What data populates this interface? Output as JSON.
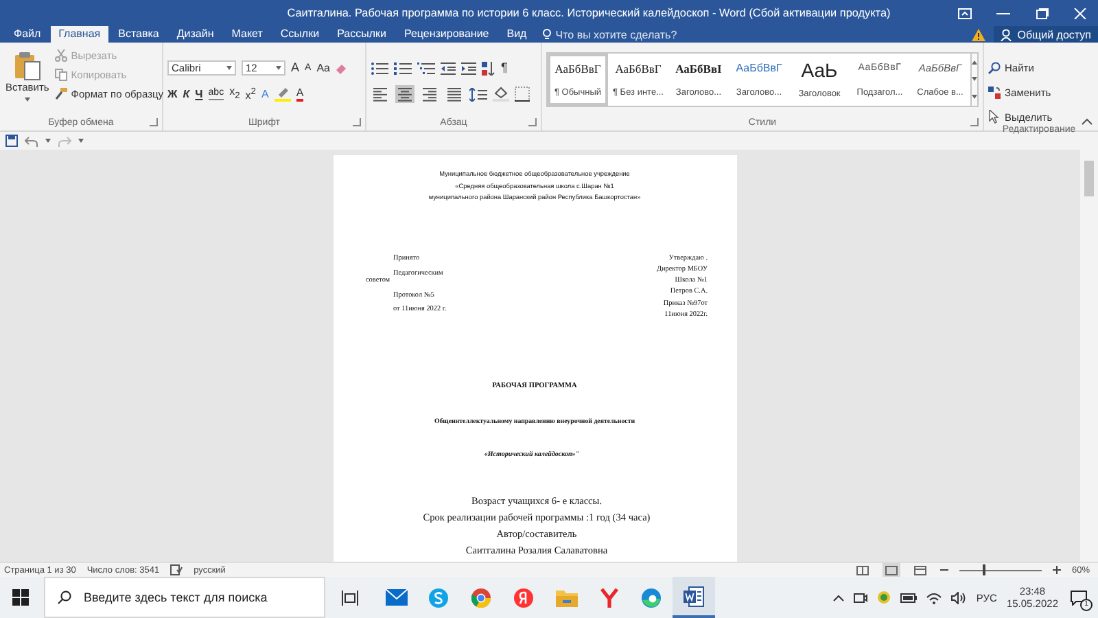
{
  "title_bar": {
    "title": "Саитгалина. Рабочая программа по истории 6 класс. Исторический калейдоскоп - Word (Сбой активации продукта)"
  },
  "tabs": [
    {
      "label": "Файл",
      "selected": false
    },
    {
      "label": "Главная",
      "selected": true
    },
    {
      "label": "Вставка",
      "selected": false
    },
    {
      "label": "Дизайн",
      "selected": false
    },
    {
      "label": "Макет",
      "selected": false
    },
    {
      "label": "Ссылки",
      "selected": false
    },
    {
      "label": "Рассылки",
      "selected": false
    },
    {
      "label": "Рецензирование",
      "selected": false
    },
    {
      "label": "Вид",
      "selected": false
    }
  ],
  "tell_me": {
    "placeholder": "Что вы хотите сделать?"
  },
  "share": {
    "label": "Общий доступ"
  },
  "clipboard": {
    "paste": "Вставить",
    "items": [
      {
        "label": "Вырезать",
        "kind": "cut",
        "disabled": true
      },
      {
        "label": "Копировать",
        "kind": "copy",
        "disabled": true
      },
      {
        "label": "Формат по образцу",
        "kind": "painter",
        "disabled": false
      }
    ],
    "label": "Буфер обмена"
  },
  "font": {
    "font_name": "Calibri",
    "font_size": "12",
    "grow": "A",
    "shrink": "A",
    "change_case": "Aa",
    "format_buttons": [
      "Ж",
      "К",
      "Ч",
      "abc",
      "x$_{2}$",
      "x$^{2}$"
    ],
    "effects": "A",
    "font_color": "A",
    "label": "Шрифт"
  },
  "paragraph": {
    "pilcrow": "¶",
    "alignments": [
      {
        "kind": "left",
        "selected": false
      },
      {
        "kind": "center",
        "selected": true
      },
      {
        "kind": "right",
        "selected": false
      },
      {
        "kind": "justify",
        "selected": false
      }
    ],
    "label": "Абзац"
  },
  "styles": {
    "items": [
      {
        "preview": "АаБбВвГ",
        "name": "¶ Обычный",
        "kind": "normal",
        "selected": true
      },
      {
        "preview": "АаБбВвГ",
        "name": "¶ Без инте...",
        "kind": "normal",
        "selected": false
      },
      {
        "preview": "АаБбВвI",
        "name": "Заголово...",
        "kind": "heading1",
        "selected": false
      },
      {
        "preview": "АаБбВвГ",
        "name": "Заголово...",
        "kind": "heading2",
        "selected": false
      },
      {
        "preview": "АаЬ",
        "name": "Заголовок",
        "kind": "title",
        "selected": false
      },
      {
        "preview": "АаБбВвГ",
        "name": "Подзагол...",
        "kind": "subtitle",
        "selected": false
      },
      {
        "preview": "АаБбВвГ",
        "name": "Слабое в...",
        "kind": "subtle",
        "selected": false
      }
    ],
    "label": "Стили"
  },
  "editing": {
    "items": [
      {
        "label": "Найти",
        "kind": "find"
      },
      {
        "label": "Заменить",
        "kind": "replace"
      },
      {
        "label": "Выделить",
        "kind": "select"
      }
    ],
    "label": "Редактирование"
  },
  "document": {
    "header_lines": [
      "Муниципальное бюджетное общеобразовательное учреждение",
      "«Средняя общеобразовательная школа с.Шаран №1",
      "муниципального района Шаранский район Республика Башкортостан»"
    ],
    "approved_left": [
      "Принято",
      "Педагогическим",
      "советом",
      "Протокол №5",
      "от 11июня 2022 г."
    ],
    "approved_right": [
      "Утверждаю .",
      "Директор МБОУ",
      "Школа №1",
      "Петров С.А.",
      "Приказ №97от",
      "11июня 2022г."
    ],
    "title": "РАБОЧАЯ ПРОГРАММА",
    "direction": "Общеинтеллектуальному направлению внеурочной деятельности",
    "course": "«Исторический калейдоскоп»\"",
    "info_lines": [
      "Возраст учащихся 6- е классы.",
      "Срок реализации рабочей программы :1 год (34 часа)",
      "Автор/составитель",
      "Саитгалина Розалия Салаватовна"
    ]
  },
  "status_bar": {
    "page": "Страница 1 из 30",
    "words": "Число слов: 3541",
    "language": "русский",
    "views": [
      {
        "kind": "read",
        "selected": false
      },
      {
        "kind": "print",
        "selected": true
      },
      {
        "kind": "web",
        "selected": false
      }
    ],
    "zoom": {
      "level": 0.3
    },
    "zoom_text": "60%"
  },
  "taskbar": {
    "search": {
      "placeholder": "Введите здесь текст для поиска"
    },
    "apps": [
      {
        "kind": "mail",
        "active": false
      },
      {
        "kind": "skype",
        "active": false
      },
      {
        "kind": "chrome",
        "active": false
      },
      {
        "kind": "yandex",
        "active": false
      },
      {
        "kind": "explorer",
        "active": false
      },
      {
        "kind": "ybrowser",
        "active": false
      },
      {
        "kind": "edge",
        "active": false
      },
      {
        "kind": "word",
        "active": true
      }
    ],
    "language": "РУС",
    "time": "23:48",
    "date": "15.05.2022",
    "notifications": "1"
  }
}
